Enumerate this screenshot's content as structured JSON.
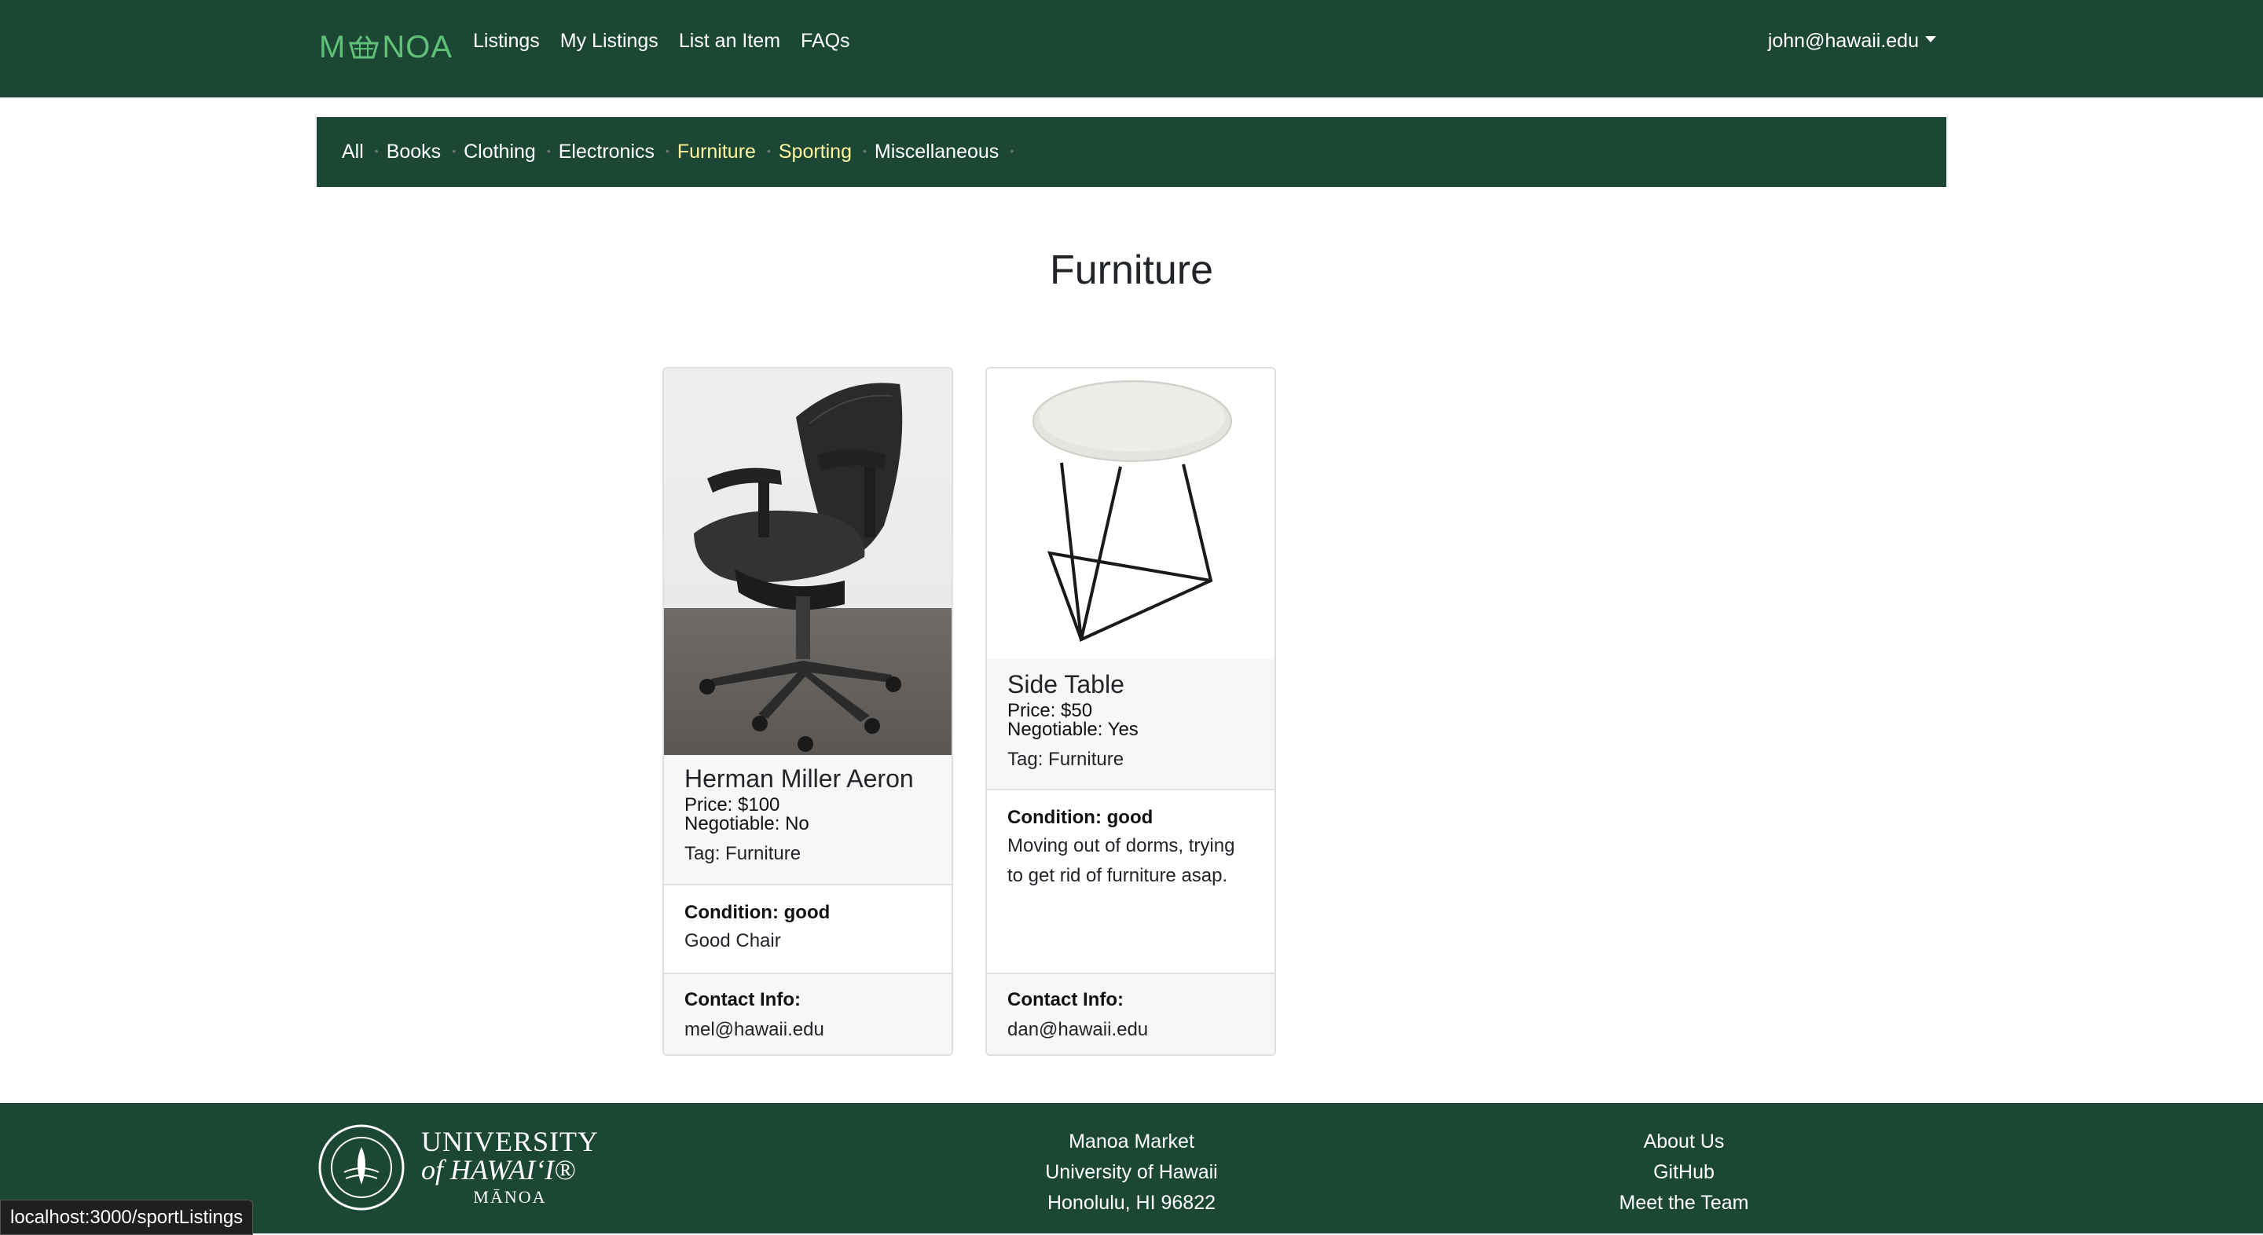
{
  "nav": {
    "brand": [
      "M",
      "NOA"
    ],
    "links": [
      "Listings",
      "My Listings",
      "List an Item",
      "FAQs"
    ],
    "user": "john@hawaii.edu"
  },
  "categories": [
    "All",
    "Books",
    "Clothing",
    "Electronics",
    "Furniture",
    "Sporting",
    "Miscellaneous"
  ],
  "page": {
    "title": "Furniture"
  },
  "cards": [
    {
      "title": "Herman Miller Aeron",
      "price": "Price: $100",
      "negotiable": "Negotiable: No",
      "tag": "Tag: Furniture",
      "condition": "Condition: good",
      "description": [
        "Good Chair"
      ],
      "contact_label": "Contact Info:",
      "contact": "mel@hawaii.edu"
    },
    {
      "title": "Side Table",
      "price": "Price: $50",
      "negotiable": "Negotiable: Yes",
      "tag": "Tag: Furniture",
      "condition": "Condition: good",
      "description": [
        "Moving out of dorms, trying",
        "to get rid of furniture asap."
      ],
      "contact_label": "Contact Info:",
      "contact": "dan@hawaii.edu"
    }
  ],
  "footer": {
    "uh_logo": [
      "UNIVERSITY",
      "of HAWAI‘I®",
      "MĀNOA"
    ],
    "center": [
      "Manoa Market",
      "University of Hawaii",
      "Honolulu, HI 96822"
    ],
    "right": [
      "About Us",
      "GitHub",
      "Meet the Team"
    ]
  },
  "status_url": "localhost:3000/sportListings",
  "colors": {
    "nav_bg": "#1d4735",
    "brand": "#5fc177",
    "highlight": "#fff59d"
  }
}
